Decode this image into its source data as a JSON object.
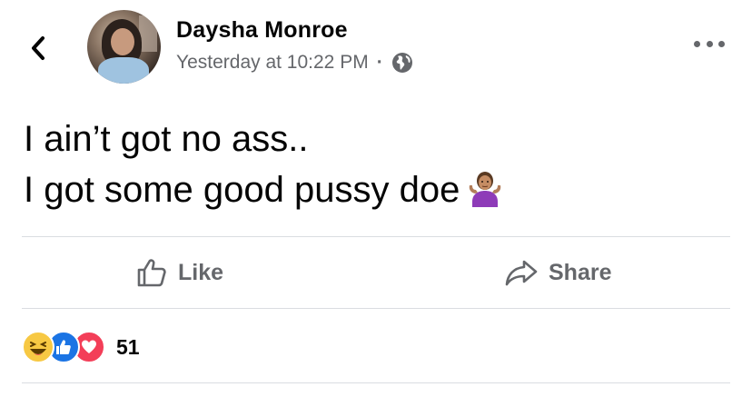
{
  "header": {
    "author_name": "Daysha Monroe",
    "timestamp": "Yesterday at 10:22 PM",
    "separator": "·",
    "privacy_icon": "globe-icon",
    "back_icon": "chevron-left-icon",
    "more_icon": "more-horizontal-icon"
  },
  "post": {
    "lines": [
      "I ain’t got no ass..",
      "I got some good pussy doe"
    ],
    "emoji": "person-shrugging-emoji"
  },
  "actions": {
    "like_label": "Like",
    "share_label": "Share"
  },
  "reactions": {
    "types": [
      "haha",
      "like",
      "love"
    ],
    "count": "51"
  },
  "colors": {
    "primary_text": "#050505",
    "secondary_text": "#65676b",
    "divider": "#dadde1",
    "like_blue": "#1b74e4",
    "love_red": "#f33e58",
    "haha_yellow": "#f7c843"
  }
}
